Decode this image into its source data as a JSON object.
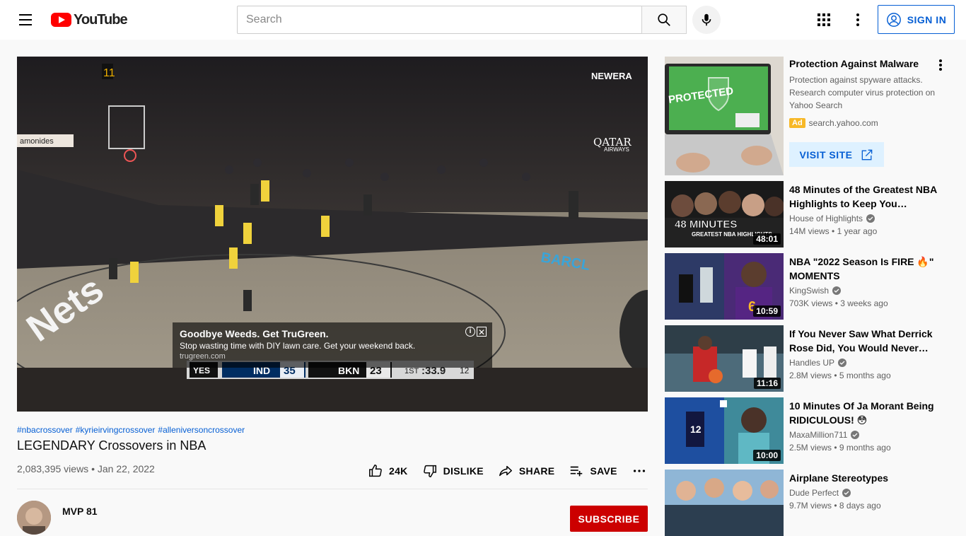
{
  "header": {
    "logo_text": "YouTube",
    "search_placeholder": "Search",
    "signin_label": "SIGN IN"
  },
  "player": {
    "scoreboard": {
      "home": "IND",
      "home_score": "35",
      "away": "BKN",
      "away_score": "23",
      "period": "1ST",
      "clock": ":33.9",
      "shot_clock": "12",
      "network": "YES"
    },
    "watermark": "NEWERA",
    "ad": {
      "title": "Goodbye Weeds. Get TruGreen.",
      "description": "Stop wasting time with DIY lawn care. Get your weekend back.",
      "url": "trugreen.com"
    }
  },
  "video": {
    "hashtags": [
      "#nbacrossover",
      "#kyrieirvingcrossover",
      "#alleniversoncrossover"
    ],
    "title": "LEGENDARY Crossovers in NBA",
    "views": "2,083,395 views",
    "date": "Jan 22, 2022",
    "likes": "24K",
    "dislike_label": "DISLIKE",
    "share_label": "SHARE",
    "save_label": "SAVE",
    "channel": "MVP 81",
    "subscribe_label": "SUBSCRIBE"
  },
  "sidebar_ad": {
    "title": "Protection Against Malware",
    "description": "Protection against spyware attacks. Research computer virus protection on Yahoo Search",
    "badge": "Ad",
    "domain": "search.yahoo.com",
    "button": "VISIT SITE",
    "thumb_text": "PROTECTED"
  },
  "recommendations": [
    {
      "title": "48 Minutes of the Greatest NBA Highlights to Keep You…",
      "channel": "House of Highlights",
      "views": "14M views",
      "age": "1 year ago",
      "duration": "48:01",
      "thumb_text": "48 MINUTES",
      "thumb_sub": "GREATEST NBA HIGHLIGHTS"
    },
    {
      "title": "NBA \"2022 Season Is FIRE 🔥\" MOMENTS",
      "channel": "KingSwish",
      "views": "703K views",
      "age": "3 weeks ago",
      "duration": "10:59"
    },
    {
      "title": "If You Never Saw What Derrick Rose Did, You Would Never…",
      "channel": "Handles UP",
      "views": "2.8M views",
      "age": "5 months ago",
      "duration": "11:16"
    },
    {
      "title": "10 Minutes Of Ja Morant Being RIDICULOUS! 😳",
      "channel": "MaxaMillion711",
      "views": "2.5M views",
      "age": "9 months ago",
      "duration": "10:00"
    },
    {
      "title": "Airplane Stereotypes",
      "channel": "Dude Perfect",
      "views": "9.7M views",
      "age": "8 days ago",
      "duration": ""
    }
  ]
}
